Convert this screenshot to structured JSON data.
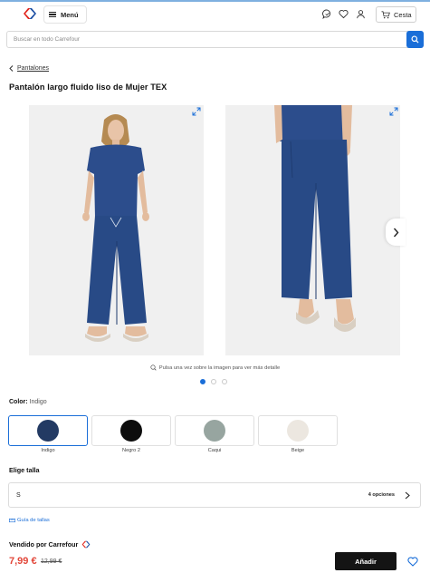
{
  "header": {
    "menu_label": "Menú",
    "cart_label": "Cesta",
    "icons": [
      "carrefour-logo",
      "hamburger-icon",
      "chat-icon",
      "heart-icon",
      "user-icon",
      "cart-icon"
    ]
  },
  "search": {
    "placeholder": "Buscar en todo Carrefour",
    "button_icon": "search-icon"
  },
  "breadcrumb": {
    "label": "Pantalones"
  },
  "product": {
    "title": "Pantalón largo fluido liso de Mujer TEX",
    "zoom_hint": "Pulsa una vez sobre la imagen para ver más detalle",
    "gallery_dots": 3,
    "active_dot": 0
  },
  "color": {
    "label": "Color:",
    "selected": "Indigo",
    "options": [
      {
        "name": "Indigo",
        "hex": "#233a63"
      },
      {
        "name": "Negro 2",
        "hex": "#0d0d0d"
      },
      {
        "name": "Caqui",
        "hex": "#97a5a0"
      },
      {
        "name": "Beige",
        "hex": "#ece7e0"
      }
    ]
  },
  "size": {
    "label": "Elige talla",
    "value": "S",
    "options_count": "4 opciones",
    "guide_label": "Guía de tallas"
  },
  "seller": {
    "label": "Vendido por Carrefour"
  },
  "price": {
    "current": "7,99 €",
    "old": "12,99 €"
  },
  "actions": {
    "add_label": "Añadir"
  },
  "colors": {
    "accent": "#1a6ed8",
    "price_red": "#e2473a",
    "button_dark": "#141414"
  }
}
